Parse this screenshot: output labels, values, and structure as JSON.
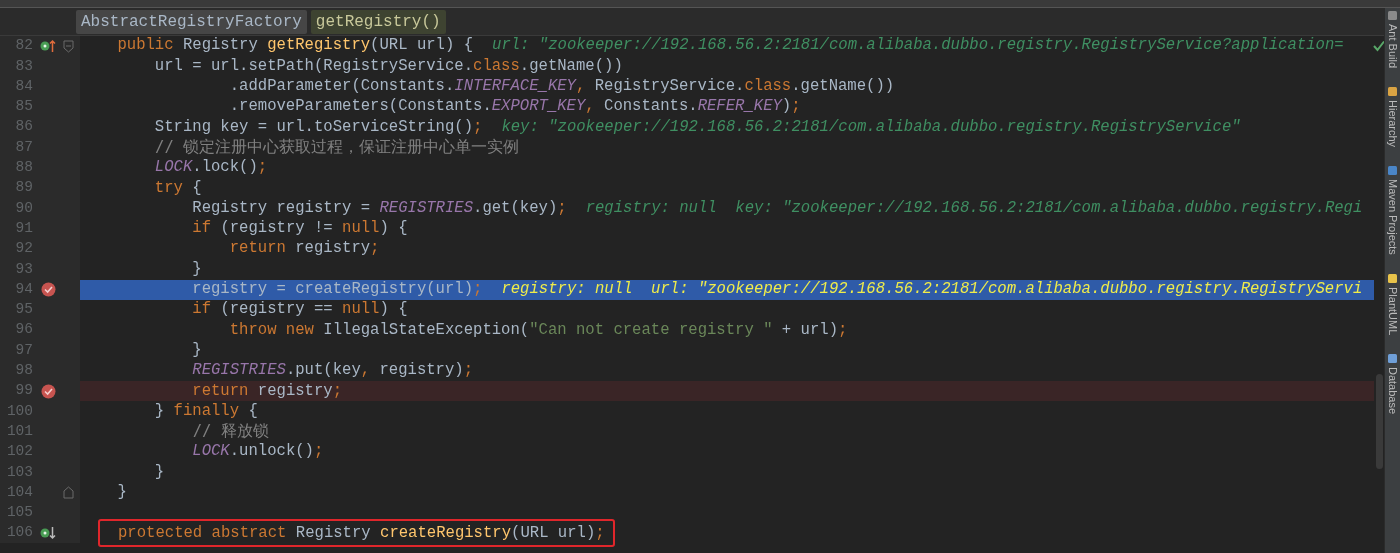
{
  "breadcrumbs": [
    {
      "label": "AbstractRegistryFactory",
      "selected": false
    },
    {
      "label": "getRegistry()",
      "selected": true
    }
  ],
  "lines": [
    {
      "number": "82",
      "kind": "plain",
      "breakpoint": false,
      "gutter_icon": {
        "kind": "override"
      },
      "fold_marker": {
        "kind": "open"
      },
      "tokens": [
        {
          "kind": "keyword",
          "text": "    public "
        },
        {
          "kind": "plain",
          "text": "Registry "
        },
        {
          "kind": "method",
          "text": "getRegistry"
        },
        {
          "kind": "plain",
          "text": "(URL url) {"
        },
        {
          "kind": "hint",
          "text": "url: \"zookeeper://192.168.56.2:2181/com.alibaba.dubbo.registry.RegistryService?application="
        }
      ]
    },
    {
      "number": "83",
      "kind": "plain",
      "breakpoint": false,
      "tokens": [
        {
          "kind": "plain",
          "text": "        url = url.setPath(RegistryService."
        },
        {
          "kind": "keyword",
          "text": "class"
        },
        {
          "kind": "plain",
          "text": ".getName())"
        }
      ]
    },
    {
      "number": "84",
      "kind": "plain",
      "breakpoint": false,
      "tokens": [
        {
          "kind": "plain",
          "text": "                .addParameter(Constants."
        },
        {
          "kind": "field",
          "text": "INTERFACE_KEY"
        },
        {
          "kind": "keyword",
          "text": ", "
        },
        {
          "kind": "plain",
          "text": "RegistryService."
        },
        {
          "kind": "keyword",
          "text": "class"
        },
        {
          "kind": "plain",
          "text": ".getName())"
        }
      ]
    },
    {
      "number": "85",
      "kind": "plain",
      "breakpoint": false,
      "tokens": [
        {
          "kind": "plain",
          "text": "                .removeParameters(Constants."
        },
        {
          "kind": "field",
          "text": "EXPORT_KEY"
        },
        {
          "kind": "keyword",
          "text": ", "
        },
        {
          "kind": "plain",
          "text": "Constants."
        },
        {
          "kind": "field",
          "text": "REFER_KEY"
        },
        {
          "kind": "plain",
          "text": ")"
        },
        {
          "kind": "keyword",
          "text": ";"
        }
      ]
    },
    {
      "number": "86",
      "kind": "plain",
      "breakpoint": false,
      "tokens": [
        {
          "kind": "plain",
          "text": "        String key = url.toServiceString()"
        },
        {
          "kind": "keyword",
          "text": ";"
        },
        {
          "kind": "hint",
          "text": "key: \"zookeeper://192.168.56.2:2181/com.alibaba.dubbo.registry.RegistryService\""
        }
      ]
    },
    {
      "number": "87",
      "kind": "plain",
      "breakpoint": false,
      "tokens": [
        {
          "kind": "comment",
          "text": "        // 锁定注册中心获取过程，保证注册中心单一实例"
        }
      ]
    },
    {
      "number": "88",
      "kind": "plain",
      "breakpoint": false,
      "tokens": [
        {
          "kind": "field",
          "text": "        LOCK"
        },
        {
          "kind": "plain",
          "text": ".lock()"
        },
        {
          "kind": "keyword",
          "text": ";"
        }
      ]
    },
    {
      "number": "89",
      "kind": "plain",
      "breakpoint": false,
      "tokens": [
        {
          "kind": "keyword",
          "text": "        try "
        },
        {
          "kind": "plain",
          "text": "{"
        }
      ]
    },
    {
      "number": "90",
      "kind": "plain",
      "breakpoint": false,
      "tokens": [
        {
          "kind": "plain",
          "text": "            Registry registry = "
        },
        {
          "kind": "field",
          "text": "REGISTRIES"
        },
        {
          "kind": "plain",
          "text": ".get(key)"
        },
        {
          "kind": "keyword",
          "text": ";"
        },
        {
          "kind": "hint",
          "text": "registry: null  key: \"zookeeper://192.168.56.2:2181/com.alibaba.dubbo.registry.Regi"
        }
      ]
    },
    {
      "number": "91",
      "kind": "plain",
      "breakpoint": false,
      "tokens": [
        {
          "kind": "keyword",
          "text": "            if "
        },
        {
          "kind": "plain",
          "text": "(registry != "
        },
        {
          "kind": "keyword",
          "text": "null"
        },
        {
          "kind": "plain",
          "text": ") {"
        }
      ]
    },
    {
      "number": "92",
      "kind": "plain",
      "breakpoint": false,
      "tokens": [
        {
          "kind": "keyword",
          "text": "                return "
        },
        {
          "kind": "plain",
          "text": "registry"
        },
        {
          "kind": "keyword",
          "text": ";"
        }
      ]
    },
    {
      "number": "93",
      "kind": "plain",
      "breakpoint": false,
      "tokens": [
        {
          "kind": "plain",
          "text": "            }"
        }
      ]
    },
    {
      "number": "94",
      "kind": "current",
      "breakpoint": true,
      "tokens": [
        {
          "kind": "plain",
          "text": "            registry = createRegistry(url)"
        },
        {
          "kind": "keyword",
          "text": ";"
        },
        {
          "kind": "hint",
          "text": "registry: null  url: \"zookeeper://192.168.56.2:2181/com.alibaba.dubbo.registry.RegistryServi"
        }
      ]
    },
    {
      "number": "95",
      "kind": "plain",
      "breakpoint": false,
      "tokens": [
        {
          "kind": "keyword",
          "text": "            if "
        },
        {
          "kind": "plain",
          "text": "(registry == "
        },
        {
          "kind": "keyword",
          "text": "null"
        },
        {
          "kind": "plain",
          "text": ") {"
        }
      ]
    },
    {
      "number": "96",
      "kind": "plain",
      "breakpoint": false,
      "tokens": [
        {
          "kind": "keyword",
          "text": "                throw new "
        },
        {
          "kind": "plain",
          "text": "IllegalStateException("
        },
        {
          "kind": "string",
          "text": "\"Can not create registry \""
        },
        {
          "kind": "plain",
          "text": " + url)"
        },
        {
          "kind": "keyword",
          "text": ";"
        }
      ]
    },
    {
      "number": "97",
      "kind": "plain",
      "breakpoint": false,
      "tokens": [
        {
          "kind": "plain",
          "text": "            }"
        }
      ]
    },
    {
      "number": "98",
      "kind": "plain",
      "breakpoint": false,
      "tokens": [
        {
          "kind": "field",
          "text": "            REGISTRIES"
        },
        {
          "kind": "plain",
          "text": ".put(key"
        },
        {
          "kind": "keyword",
          "text": ", "
        },
        {
          "kind": "plain",
          "text": "registry)"
        },
        {
          "kind": "keyword",
          "text": ";"
        }
      ]
    },
    {
      "number": "99",
      "kind": "breakpoint_line",
      "breakpoint": true,
      "tokens": [
        {
          "kind": "keyword",
          "text": "            return "
        },
        {
          "kind": "plain",
          "text": "registry"
        },
        {
          "kind": "keyword",
          "text": ";"
        }
      ]
    },
    {
      "number": "100",
      "kind": "plain",
      "breakpoint": false,
      "tokens": [
        {
          "kind": "plain",
          "text": "        } "
        },
        {
          "kind": "keyword",
          "text": "finally "
        },
        {
          "kind": "plain",
          "text": "{"
        }
      ]
    },
    {
      "number": "101",
      "kind": "plain",
      "breakpoint": false,
      "tokens": [
        {
          "kind": "comment",
          "text": "            // 释放锁"
        }
      ]
    },
    {
      "number": "102",
      "kind": "plain",
      "breakpoint": false,
      "tokens": [
        {
          "kind": "field",
          "text": "            LOCK"
        },
        {
          "kind": "plain",
          "text": ".unlock()"
        },
        {
          "kind": "keyword",
          "text": ";"
        }
      ]
    },
    {
      "number": "103",
      "kind": "plain",
      "breakpoint": false,
      "tokens": [
        {
          "kind": "plain",
          "text": "        }"
        }
      ]
    },
    {
      "number": "104",
      "kind": "plain",
      "breakpoint": false,
      "fold_marker": {
        "kind": "close"
      },
      "tokens": [
        {
          "kind": "plain",
          "text": "    }"
        }
      ]
    },
    {
      "number": "105",
      "kind": "plain",
      "breakpoint": false
    },
    {
      "number": "106",
      "kind": "boxed",
      "breakpoint": false,
      "gutter_icon": {
        "kind": "implemented"
      },
      "tokens": [
        {
          "kind": "keyword",
          "text": "protected abstract "
        },
        {
          "kind": "plain",
          "text": "Registry "
        },
        {
          "kind": "method",
          "text": "createRegistry"
        },
        {
          "kind": "plain",
          "text": "(URL url)"
        },
        {
          "kind": "keyword",
          "text": ";"
        }
      ]
    }
  ],
  "tool_windows": [
    {
      "label": "Ant Build",
      "kind": "ant"
    },
    {
      "label": "Hierarchy",
      "kind": "hierarchy"
    },
    {
      "label": "Maven Projects",
      "kind": "maven"
    },
    {
      "label": "PlantUML",
      "kind": "plantuml"
    },
    {
      "label": "Database",
      "kind": "database"
    }
  ]
}
